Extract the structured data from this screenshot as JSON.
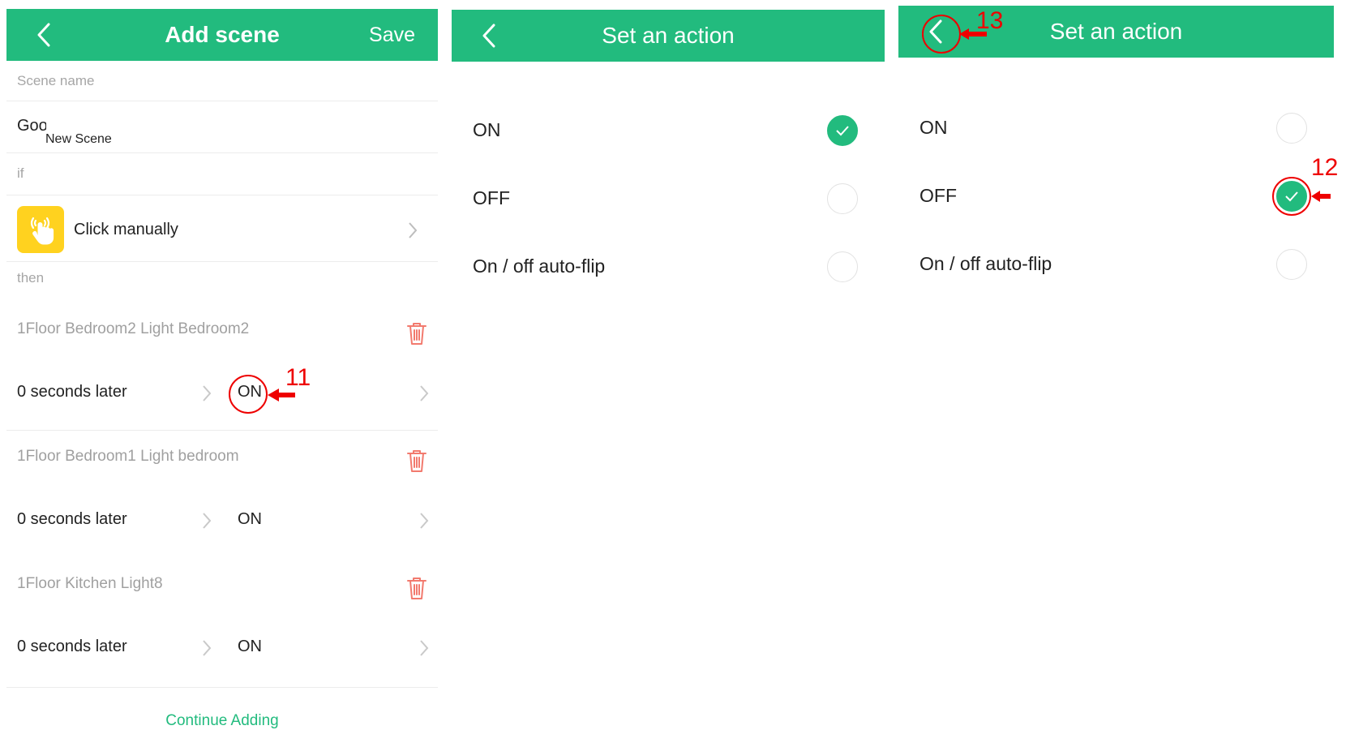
{
  "colors": {
    "accent": "#22bb7e",
    "trigger_icon_bg": "#ffd21f",
    "delete_icon": "#f27a6e",
    "annotation": "#e00000"
  },
  "add_scene": {
    "title": "Add scene",
    "back_icon": "chevron-left-icon",
    "save_label": "Save",
    "scene_name_label": "Scene name",
    "scene_name_value": "Good night",
    "tooltip_text": "New Scene",
    "if_label": "if",
    "trigger": {
      "icon": "hand-tap-icon",
      "label": "Click manually"
    },
    "then_label": "then",
    "actions": [
      {
        "device": "1Floor Bedroom2 Light Bedroom2",
        "delay": "0 seconds later",
        "action": "ON"
      },
      {
        "device": "1Floor Bedroom1 Light bedroom",
        "delay": "0 seconds later",
        "action": "ON"
      },
      {
        "device": "1Floor Kitchen Light8",
        "delay": "0 seconds later",
        "action": "ON"
      }
    ],
    "continue_label": "Continue Adding"
  },
  "set_action_before": {
    "title": "Set an action",
    "options": [
      {
        "label": "ON",
        "checked": true
      },
      {
        "label": "OFF",
        "checked": false
      },
      {
        "label": "On / off auto-flip",
        "checked": false
      }
    ]
  },
  "set_action_after": {
    "title": "Set an action",
    "options": [
      {
        "label": "ON",
        "checked": false
      },
      {
        "label": "OFF",
        "checked": true
      },
      {
        "label": "On / off auto-flip",
        "checked": false
      }
    ]
  },
  "annotations": {
    "step_11": "11",
    "step_12": "12",
    "step_13": "13"
  }
}
